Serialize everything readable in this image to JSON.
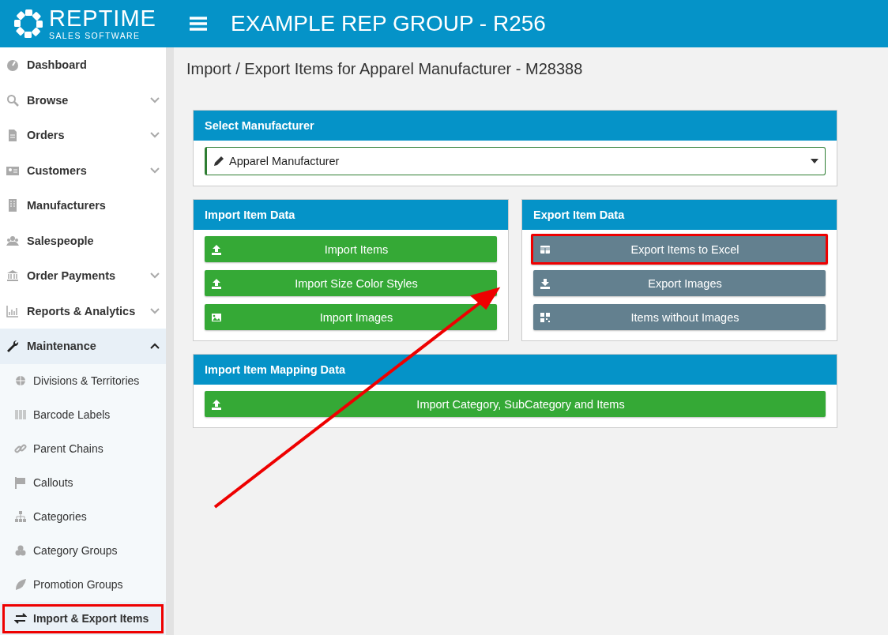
{
  "header": {
    "logo_name": "REPTIME",
    "logo_tagline": "SALES SOFTWARE",
    "title": "EXAMPLE REP GROUP - R256"
  },
  "sidebar": {
    "items": [
      {
        "label": "Dashboard",
        "selected": false
      },
      {
        "label": "Browse",
        "selected": false,
        "expanded": false
      },
      {
        "label": "Orders",
        "selected": false,
        "expanded": false
      },
      {
        "label": "Customers",
        "selected": false,
        "expanded": false
      },
      {
        "label": "Manufacturers",
        "selected": false
      },
      {
        "label": "Salespeople",
        "selected": false
      },
      {
        "label": "Order Payments",
        "selected": false,
        "expanded": false
      },
      {
        "label": "Reports & Analytics",
        "selected": false,
        "expanded": false
      },
      {
        "label": "Maintenance",
        "selected": true,
        "expanded": true,
        "children": [
          {
            "label": "Divisions & Territories",
            "selected": false,
            "highlighted": false
          },
          {
            "label": "Barcode Labels",
            "selected": false,
            "highlighted": false
          },
          {
            "label": "Parent Chains",
            "selected": false,
            "highlighted": false
          },
          {
            "label": "Callouts",
            "selected": false,
            "highlighted": false
          },
          {
            "label": "Categories",
            "selected": false,
            "highlighted": false
          },
          {
            "label": "Category Groups",
            "selected": false,
            "highlighted": false
          },
          {
            "label": "Promotion Groups",
            "selected": false,
            "highlighted": false
          },
          {
            "label": "Import & Export Items",
            "selected": true,
            "highlighted": true
          }
        ]
      }
    ]
  },
  "page_title": "Import / Export Items for Apparel Manufacturer - M28388",
  "manufacturer_panel": {
    "title": "Select Manufacturer",
    "value": "Apparel Manufacturer"
  },
  "import_panel": {
    "title": "Import Item Data",
    "buttons": [
      {
        "label": "Import Items",
        "highlighted": false
      },
      {
        "label": "Import Size Color Styles",
        "highlighted": false
      },
      {
        "label": "Import Images",
        "highlighted": false
      }
    ]
  },
  "export_panel": {
    "title": "Export Item Data",
    "buttons": [
      {
        "label": "Export Items to Excel",
        "highlighted": true
      },
      {
        "label": "Export Images",
        "highlighted": false
      },
      {
        "label": "Items without Images",
        "highlighted": false
      }
    ]
  },
  "mapping_panel": {
    "title": "Import Item Mapping Data",
    "buttons": [
      {
        "label": "Import Category, SubCategory and Items",
        "highlighted": false
      }
    ]
  }
}
